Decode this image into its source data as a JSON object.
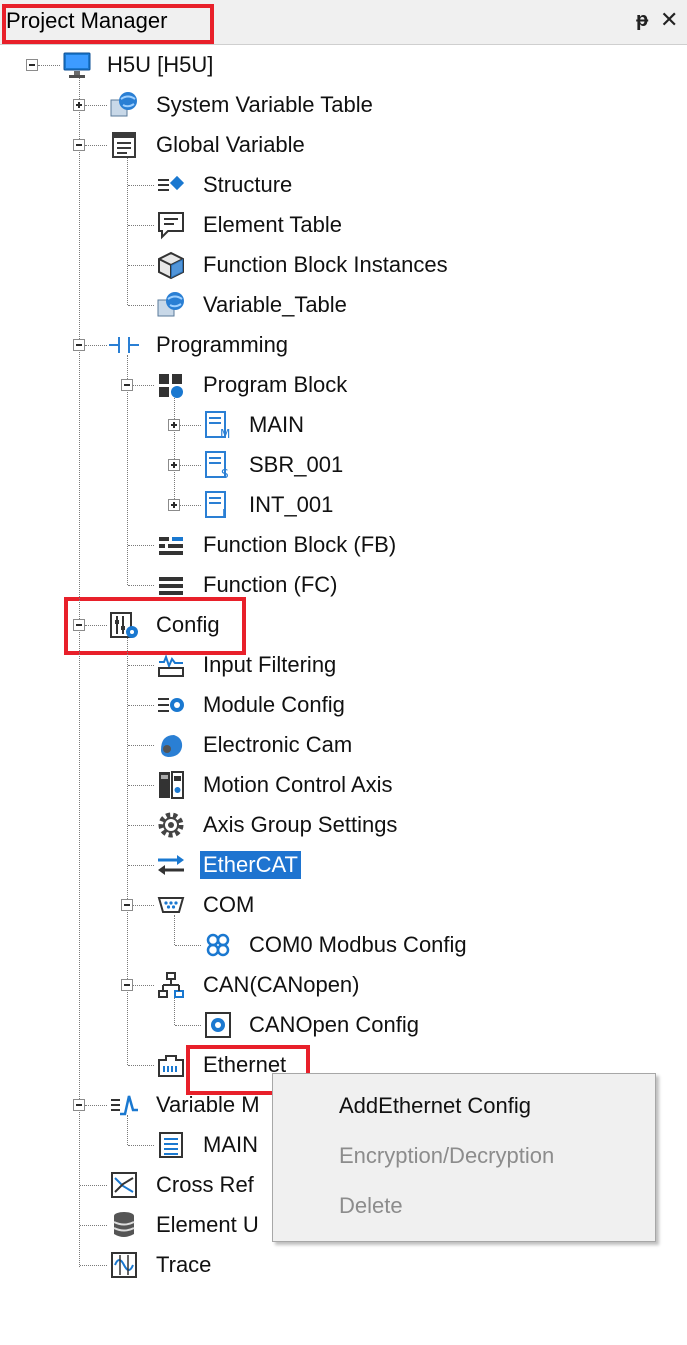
{
  "panel": {
    "title": "Project Manager",
    "pin_glyph": "ᵽ",
    "close_glyph": "✕"
  },
  "tree": {
    "root": "H5U [H5U]",
    "system_variable_table": "System Variable Table",
    "global_variable": "Global Variable",
    "structure": "Structure",
    "element_table": "Element Table",
    "function_block_instances": "Function Block Instances",
    "variable_table": "Variable_Table",
    "programming": "Programming",
    "program_block": "Program Block",
    "main": "MAIN",
    "sbr_001": "SBR_001",
    "int_001": "INT_001",
    "function_block_fb": "Function Block (FB)",
    "function_fc": "Function (FC)",
    "config": "Config",
    "input_filtering": "Input Filtering",
    "module_config": "Module Config",
    "electronic_cam": "Electronic Cam",
    "motion_control_axis": "Motion Control Axis",
    "axis_group_settings": "Axis Group Settings",
    "ethercat": "EtherCAT",
    "com": "COM",
    "com0_modbus_config": "COM0 Modbus Config",
    "can_canopen": "CAN(CANopen)",
    "canopen_config": "CANOpen Config",
    "ethernet": "Ethernet",
    "variable_monitor": "Variable M",
    "variable_monitor_main": "MAIN",
    "cross_reference": "Cross Ref",
    "element_usage": "Element U",
    "trace": "Trace"
  },
  "context_menu": {
    "items": [
      {
        "label": "AddEthernet Config",
        "enabled": true
      },
      {
        "label": "Encryption/Decryption",
        "enabled": false
      },
      {
        "label": "Delete",
        "enabled": false
      }
    ]
  },
  "colors": {
    "highlight_outline": "#e8202a",
    "selection": "#1e74d0",
    "disabled_text": "#8c8c8c"
  }
}
